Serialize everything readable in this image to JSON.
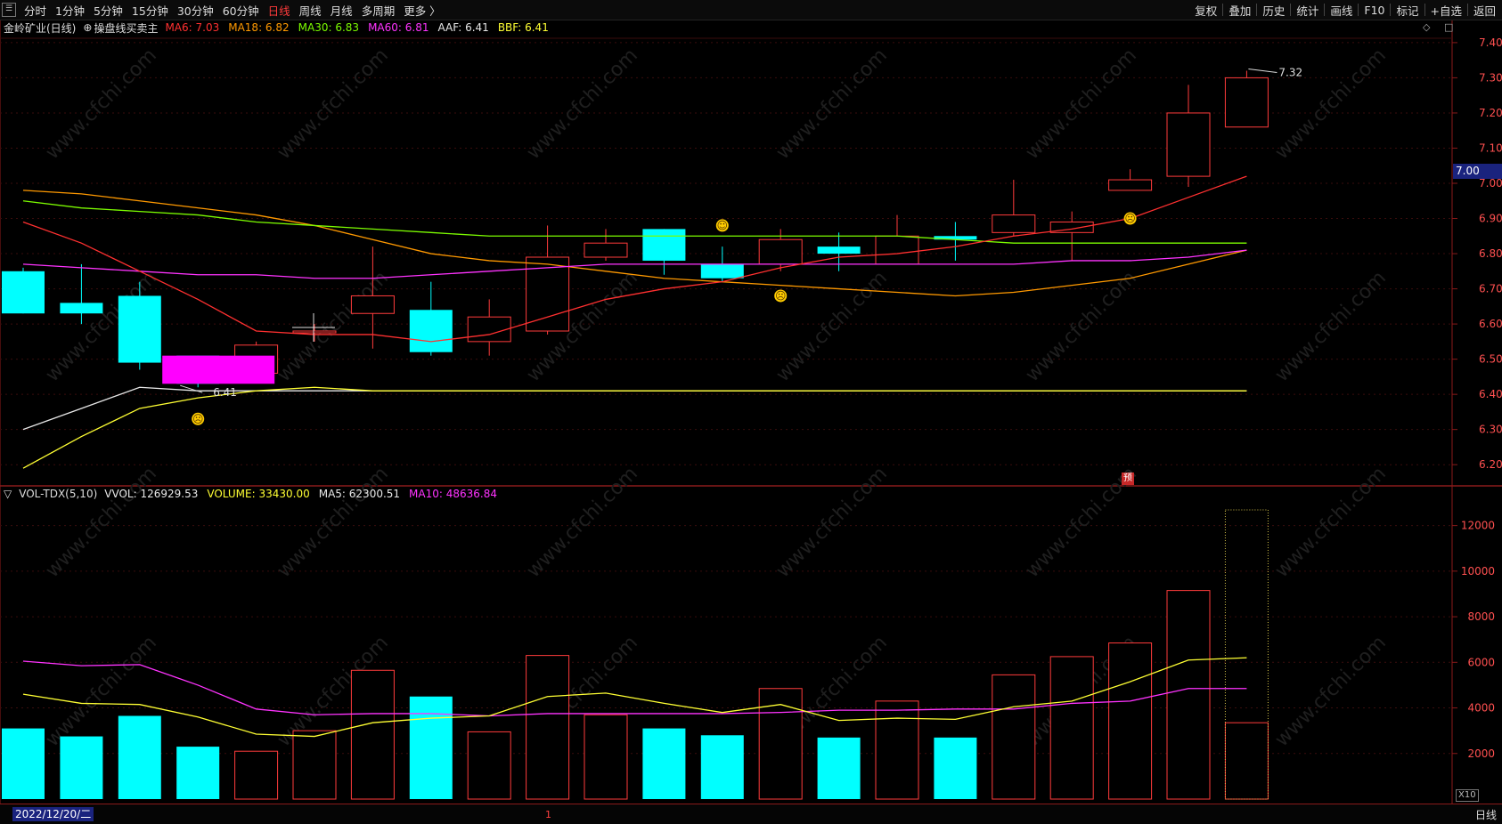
{
  "toolbar": {
    "left_items": [
      "分时",
      "1分钟",
      "5分钟",
      "15分钟",
      "30分钟",
      "60分钟",
      "日线",
      "周线",
      "月线",
      "多周期",
      "更多 〉"
    ],
    "active_item": "日线",
    "right_items": [
      "复权",
      "叠加",
      "历史",
      "统计",
      "画线",
      "F10",
      "标记",
      "+自选",
      "返回"
    ]
  },
  "main_legend": {
    "title": "金岭矿业(日线)",
    "indicator": "操盘线买卖主",
    "items": [
      {
        "label": "MA6: 7.03",
        "color": "#ff3030"
      },
      {
        "label": "MA18: 6.82",
        "color": "#ff9900"
      },
      {
        "label": "MA30: 6.83",
        "color": "#7cfc00"
      },
      {
        "label": "MA60: 6.81",
        "color": "#ff33ff"
      },
      {
        "label": "AAF: 6.41",
        "color": "#e8e8e8"
      },
      {
        "label": "BBF: 6.41",
        "color": "#ffff33"
      }
    ]
  },
  "vol_legend": {
    "title": "VOL-TDX(5,10)",
    "items": [
      {
        "label": "VVOL: 126929.53",
        "color": "#e8e8e8"
      },
      {
        "label": "VOLUME: 33430.00",
        "color": "#ffff33"
      },
      {
        "label": "MA5: 62300.51",
        "color": "#e8e8e8"
      },
      {
        "label": "MA10: 48636.84",
        "color": "#ff33ff"
      }
    ]
  },
  "price_axis": [
    "7.40",
    "7.30",
    "7.20",
    "7.10",
    "7.00",
    "6.90",
    "6.80",
    "6.70",
    "6.60",
    "6.50",
    "6.40",
    "6.30",
    "6.20"
  ],
  "vol_axis": [
    "12000",
    "10000",
    "8000",
    "6000",
    "4000",
    "2000"
  ],
  "current_price_tag": "7.00",
  "high_label": "7.32",
  "low_label": "6.41",
  "preview_mark": "预",
  "scale_badge": "X10",
  "watermark": "www.cfchi.com",
  "bottom": {
    "date": "2022/12/20/二",
    "timeframe": "日线",
    "marker": "1"
  },
  "chart_data": {
    "type": "candlestick",
    "candles": [
      {
        "o": 6.75,
        "c": 6.63,
        "h": 6.76,
        "l": 6.63
      },
      {
        "o": 6.66,
        "c": 6.63,
        "h": 6.77,
        "l": 6.6
      },
      {
        "o": 6.68,
        "c": 6.49,
        "h": 6.72,
        "l": 6.47
      },
      {
        "o": 6.51,
        "c": 6.43,
        "h": 6.51,
        "l": 6.42
      },
      {
        "o": 6.46,
        "c": 6.54,
        "h": 6.55,
        "l": 6.44
      },
      {
        "o": 6.58,
        "c": 6.58,
        "h": 6.6,
        "l": 6.55
      },
      {
        "o": 6.63,
        "c": 6.68,
        "h": 6.82,
        "l": 6.53
      },
      {
        "o": 6.64,
        "c": 6.52,
        "h": 6.72,
        "l": 6.51
      },
      {
        "o": 6.55,
        "c": 6.62,
        "h": 6.67,
        "l": 6.51
      },
      {
        "o": 6.58,
        "c": 6.79,
        "h": 6.88,
        "l": 6.57
      },
      {
        "o": 6.79,
        "c": 6.83,
        "h": 6.87,
        "l": 6.78
      },
      {
        "o": 6.87,
        "c": 6.78,
        "h": 6.87,
        "l": 6.74
      },
      {
        "o": 6.77,
        "c": 6.73,
        "h": 6.82,
        "l": 6.72
      },
      {
        "o": 6.77,
        "c": 6.84,
        "h": 6.87,
        "l": 6.75
      },
      {
        "o": 6.82,
        "c": 6.8,
        "h": 6.86,
        "l": 6.75
      },
      {
        "o": 6.77,
        "c": 6.85,
        "h": 6.91,
        "l": 6.77
      },
      {
        "o": 6.85,
        "c": 6.84,
        "h": 6.89,
        "l": 6.78
      },
      {
        "o": 6.86,
        "c": 6.91,
        "h": 7.01,
        "l": 6.85
      },
      {
        "o": 6.86,
        "c": 6.89,
        "h": 6.92,
        "l": 6.78
      },
      {
        "o": 6.98,
        "c": 7.01,
        "h": 7.04,
        "l": 6.98
      },
      {
        "o": 7.02,
        "c": 7.2,
        "h": 7.28,
        "l": 6.99
      },
      {
        "o": 7.16,
        "c": 7.3,
        "h": 7.32,
        "l": 7.16
      }
    ],
    "highlight_candle": {
      "o": 6.51,
      "c": 6.43,
      "color": "#ff00ff"
    },
    "ma6": [
      6.89,
      6.83,
      6.75,
      6.67,
      6.58,
      6.57,
      6.57,
      6.55,
      6.57,
      6.62,
      6.67,
      6.7,
      6.72,
      6.76,
      6.79,
      6.8,
      6.82,
      6.85,
      6.87,
      6.9,
      6.96,
      7.02
    ],
    "ma18": [
      6.98,
      6.97,
      6.95,
      6.93,
      6.91,
      6.88,
      6.84,
      6.8,
      6.78,
      6.77,
      6.75,
      6.73,
      6.72,
      6.71,
      6.7,
      6.69,
      6.68,
      6.69,
      6.71,
      6.73,
      6.77,
      6.81
    ],
    "ma30": [
      6.95,
      6.93,
      6.92,
      6.91,
      6.89,
      6.88,
      6.87,
      6.86,
      6.85,
      6.85,
      6.85,
      6.85,
      6.85,
      6.85,
      6.85,
      6.85,
      6.84,
      6.83,
      6.83,
      6.83,
      6.83,
      6.83
    ],
    "ma60": [
      6.77,
      6.76,
      6.75,
      6.74,
      6.74,
      6.73,
      6.73,
      6.74,
      6.75,
      6.76,
      6.77,
      6.77,
      6.77,
      6.77,
      6.77,
      6.77,
      6.77,
      6.77,
      6.78,
      6.78,
      6.79,
      6.81
    ],
    "aaf": [
      6.3,
      6.36,
      6.42,
      6.41,
      6.41,
      6.41,
      6.41,
      6.41,
      6.41,
      6.41,
      6.41,
      6.41,
      6.41,
      6.41,
      6.41,
      6.41,
      6.41,
      6.41,
      6.41,
      6.41,
      6.41,
      6.41
    ],
    "bbf": [
      6.19,
      6.28,
      6.36,
      6.39,
      6.41,
      6.42,
      6.41,
      6.41,
      6.41,
      6.41,
      6.41,
      6.41,
      6.41,
      6.41,
      6.41,
      6.41,
      6.41,
      6.41,
      6.41,
      6.41,
      6.41,
      6.41
    ],
    "volumes": [
      3100,
      2750,
      3650,
      2300,
      2100,
      3000,
      5650,
      4500,
      2950,
      6300,
      3700,
      3100,
      2800,
      4850,
      2700,
      4300,
      2700,
      5450,
      6250,
      6850,
      9150,
      3350
    ],
    "vvol_last": 12690,
    "vol_ma5": [
      4600,
      4200,
      4150,
      3600,
      2850,
      2750,
      3350,
      3550,
      3650,
      4500,
      4650,
      4200,
      3800,
      4150,
      3450,
      3550,
      3500,
      4050,
      4300,
      5150,
      6100,
      6200
    ],
    "vol_ma10": [
      6050,
      5850,
      5900,
      5000,
      3950,
      3700,
      3750,
      3750,
      3650,
      3750,
      3750,
      3750,
      3750,
      3800,
      3900,
      3900,
      3950,
      3950,
      4200,
      4300,
      4850,
      4850
    ],
    "ylim_price": [
      6.16,
      7.42
    ],
    "ylim_vol": [
      0,
      13000
    ],
    "emoji_marks": [
      {
        "index": 3,
        "price": 6.33,
        "glyph": "☹"
      },
      {
        "index": 12,
        "price": 6.88,
        "glyph": "☺"
      },
      {
        "index": 13,
        "price": 6.68,
        "glyph": "☹"
      },
      {
        "index": 19,
        "price": 6.9,
        "glyph": "☹"
      }
    ]
  }
}
